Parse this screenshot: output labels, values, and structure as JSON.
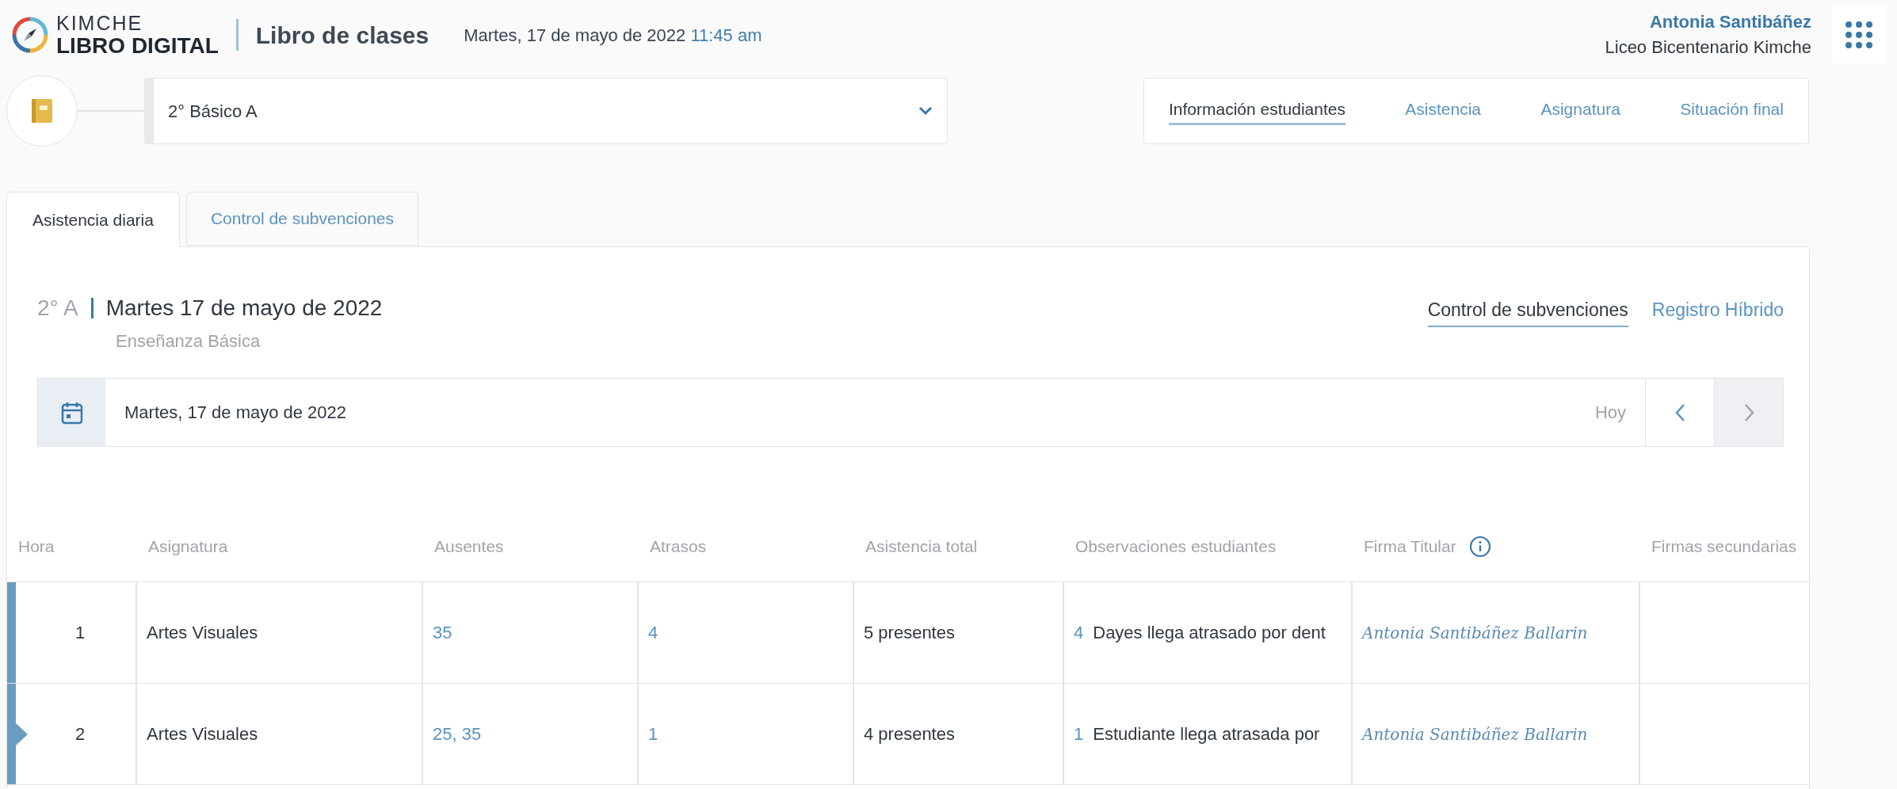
{
  "header": {
    "logo": {
      "line_1": "KIMCHE",
      "line_2": "LIBRO DIGITAL"
    },
    "title": "Libro de clases",
    "date": "Martes, 17 de mayo de 2022",
    "time": "11:45 am",
    "user": {
      "name": "Antonia Santibáñez",
      "school": "Liceo Bicentenario Kimche"
    }
  },
  "course_select": {
    "value": "2° Básico A"
  },
  "nav": [
    {
      "label": "Información estudiantes",
      "selected": true
    },
    {
      "label": "Asistencia",
      "selected": false
    },
    {
      "label": "Asignatura",
      "selected": false
    },
    {
      "label": "Situación final",
      "selected": false
    }
  ],
  "tabs": [
    {
      "label": "Asistencia diaria",
      "selected": true
    },
    {
      "label": "Control de subvenciones",
      "selected": false
    }
  ],
  "panel": {
    "course": "2° A",
    "date_title": "Martes 17 de mayo de 2022",
    "subtitle": "Enseñanza Básica",
    "links": [
      {
        "label": "Control de subvenciones",
        "selected": true
      },
      {
        "label": "Registro Híbrido",
        "selected": false
      }
    ],
    "date_bar": {
      "date": "Martes, 17 de mayo de 2022",
      "today": "Hoy",
      "buttons": [
        {
          "kind": "prev",
          "disabled": false
        },
        {
          "kind": "next",
          "disabled": true
        }
      ]
    },
    "table": {
      "columns": [
        "Hora",
        "Asignatura",
        "Ausentes",
        "Atrasos",
        "Asistencia total",
        "Observaciones estudiantes",
        "Firma Titular",
        "Firmas secundarias"
      ],
      "rows": [
        {
          "hora": "1",
          "asignatura": "Artes Visuales",
          "ausentes": "35",
          "atrasos": "4",
          "asistencia_total": "5 presentes",
          "obs_count": "4",
          "observation": "Dayes llega atrasado por dent",
          "signature": "Antonia Santibáñez Ballarin",
          "selected": false
        },
        {
          "hora": "2",
          "asignatura": "Artes Visuales",
          "ausentes": "25, 35",
          "atrasos": "1",
          "asistencia_total": "4 presentes",
          "obs_count": "1",
          "observation": "Estudiante llega atrasada por",
          "signature": "Antonia Santibáñez Ballarin",
          "selected": true
        }
      ]
    }
  }
}
